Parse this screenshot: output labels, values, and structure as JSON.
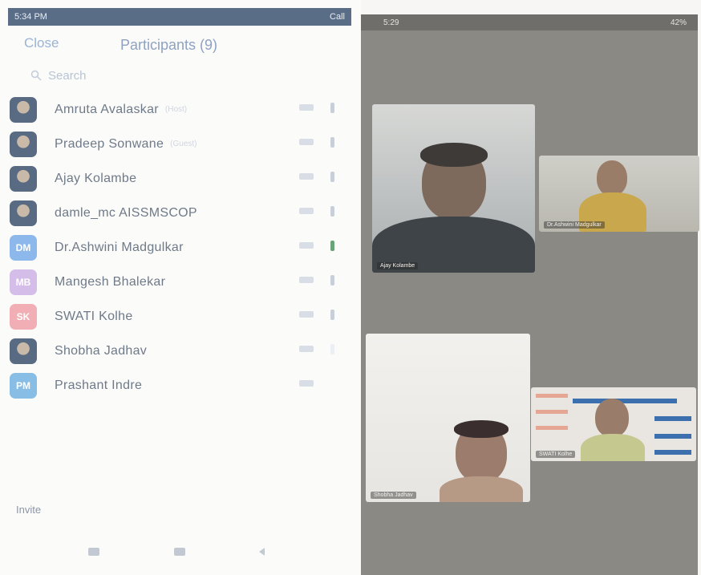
{
  "left_phone": {
    "status_bar": {
      "time": "5:34 PM",
      "right": "Call"
    },
    "header": {
      "close_label": "Close",
      "title": "Participants (9)"
    },
    "search": {
      "placeholder": "Search"
    },
    "participants": [
      {
        "name": "Amruta Avalaskar",
        "tag": "(Host)",
        "avatar": "photo",
        "initials": "",
        "color": "",
        "video": "normal"
      },
      {
        "name": "Pradeep Sonwane",
        "tag": "(Guest)",
        "avatar": "photo",
        "initials": "",
        "color": "",
        "video": "normal"
      },
      {
        "name": "Ajay Kolambe",
        "tag": "",
        "avatar": "photo",
        "initials": "",
        "color": "",
        "video": "normal"
      },
      {
        "name": "damle_mc AISSMSCOP",
        "tag": "",
        "avatar": "photo",
        "initials": "",
        "color": "",
        "video": "normal"
      },
      {
        "name": "Dr.Ashwini Madgulkar",
        "tag": "",
        "avatar": "initials",
        "initials": "DM",
        "color": "#8db8ec",
        "video": "green"
      },
      {
        "name": "Mangesh Bhalekar",
        "tag": "",
        "avatar": "initials",
        "initials": "MB",
        "color": "#d4bde8",
        "video": "normal"
      },
      {
        "name": "SWATI Kolhe",
        "tag": "",
        "avatar": "initials",
        "initials": "SK",
        "color": "#f1aeb5",
        "video": "normal"
      },
      {
        "name": "Shobha Jadhav",
        "tag": "",
        "avatar": "photo",
        "initials": "",
        "color": "",
        "video": "faint"
      },
      {
        "name": "Prashant Indre",
        "tag": "",
        "avatar": "initials",
        "initials": "PM",
        "color": "#88bde6",
        "video": "none"
      }
    ],
    "invite_label": "Invite",
    "nav_icons": [
      "recent-apps-icon",
      "home-icon",
      "back-icon"
    ]
  },
  "right_phone": {
    "status_bar": {
      "time": "5:29",
      "battery": "42%"
    },
    "tiles": [
      {
        "name": "Ajay Kolambe"
      },
      {
        "name": "Dr.Ashwini Madgulkar"
      },
      {
        "name": "Shobha Jadhav"
      },
      {
        "name": "SWATI Kolhe"
      }
    ]
  },
  "colors": {
    "status_bar_left": "#5a6d86",
    "title_text": "#8fa2c2",
    "video_on_green": "#6aa376"
  }
}
